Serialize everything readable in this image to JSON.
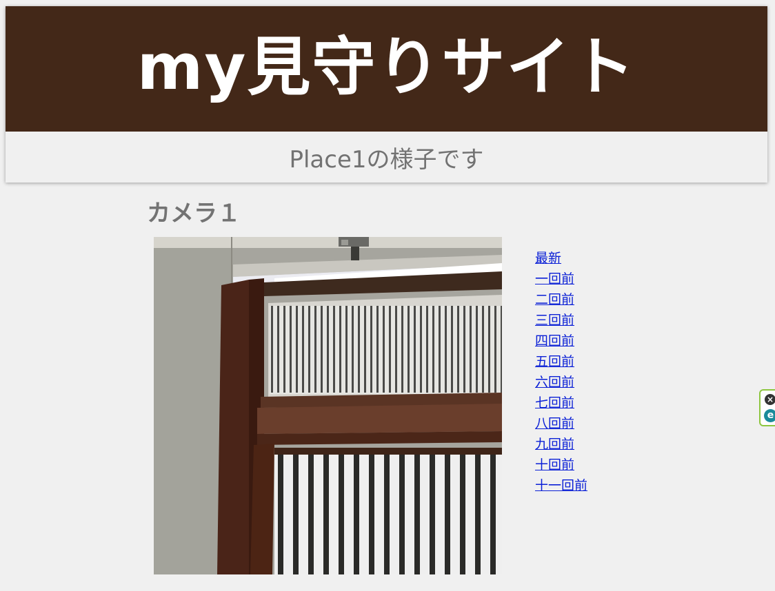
{
  "site": {
    "title": "my見守りサイト",
    "subtitle": "Place1の様子です",
    "banner_color": "#432818"
  },
  "camera": {
    "heading": "カメラ１",
    "image_alt": "camera snapshot of a window with vertical blinds"
  },
  "snapshot_links": [
    "最新",
    "一回前",
    "二回前",
    "三回前",
    "四回前",
    "五回前",
    "六回前",
    "七回前",
    "八回前",
    "九回前",
    "十回前",
    "十一回前"
  ],
  "extension_badge": {
    "close_icon": "close-icon",
    "logo_icon": "extension-logo-icon",
    "close_glyph": "×",
    "logo_glyph": "e"
  },
  "colors": {
    "link": "#0a1fd6",
    "heading": "#737373",
    "page_bg": "#f0f0f0"
  }
}
